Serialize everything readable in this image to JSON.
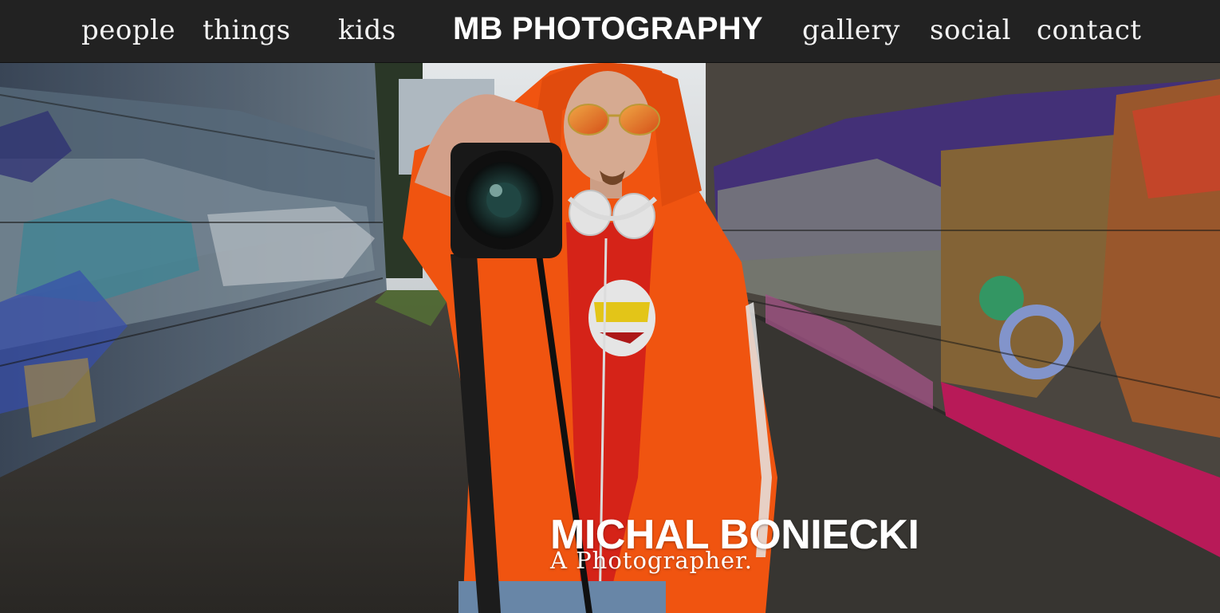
{
  "nav": {
    "brand": "MB PHOTOGRAPHY",
    "left_links": [
      "people",
      "things",
      "kids"
    ],
    "right_links": [
      "gallery",
      "social",
      "contact"
    ]
  },
  "hero": {
    "title": "MICHAL BONIECKI",
    "subtitle": "A  Photographer."
  },
  "colors": {
    "navbar_bg": "#222222",
    "nav_text": "#f2f2f2",
    "hoodie": "#ff5a12",
    "accent_pink": "#d21e6e"
  },
  "icons": {
    "camera": "camera-icon",
    "headphones": "headphones-icon"
  }
}
